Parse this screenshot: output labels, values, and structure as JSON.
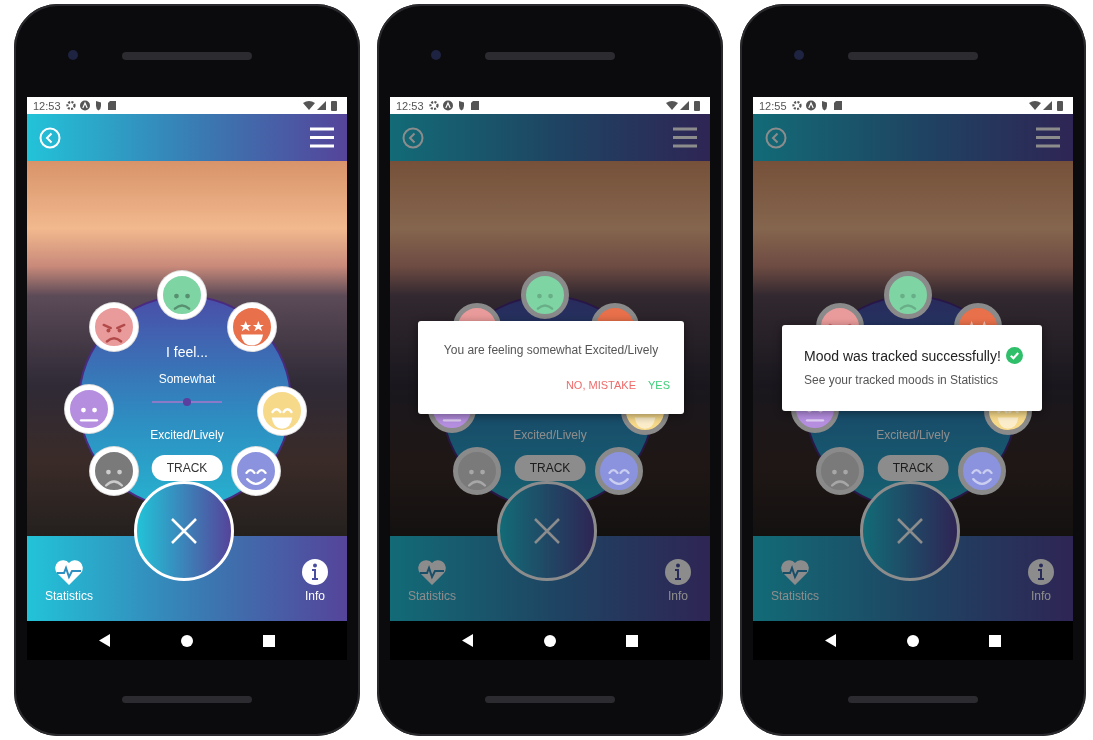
{
  "phones": [
    {
      "status": {
        "time": "12:53"
      },
      "wheel": {
        "faces": [
          {
            "kind": "sad",
            "color": "#7fd4a4"
          },
          {
            "kind": "starstruck",
            "color": "#e8704a"
          },
          {
            "kind": "grinning",
            "color": "#f7d98a"
          },
          {
            "kind": "smiling",
            "color": "#8b93de"
          },
          {
            "kind": "frowning",
            "color": "#7a7a7a"
          },
          {
            "kind": "neutral",
            "color": "#b58ee0"
          },
          {
            "kind": "angry",
            "color": "#e99a9a"
          }
        ],
        "heading": "I feel...",
        "intensity": "Somewhat",
        "slider": {
          "level": 0.5
        },
        "mood": "Excited/Lively",
        "track": "TRACK"
      },
      "nav": [
        {
          "kind": "heart",
          "label": "Statistics"
        },
        {
          "kind": "info",
          "label": "Info"
        }
      ]
    },
    {
      "status": {
        "time": "12:53"
      },
      "wheel": {
        "faces": [
          {
            "kind": "sad",
            "color": "#7fd4a4"
          },
          {
            "kind": "starstruck",
            "color": "#e8704a"
          },
          {
            "kind": "grinning",
            "color": "#f7d98a"
          },
          {
            "kind": "smiling",
            "color": "#8b93de"
          },
          {
            "kind": "frowning",
            "color": "#7a7a7a"
          },
          {
            "kind": "neutral",
            "color": "#b58ee0"
          },
          {
            "kind": "angry",
            "color": "#e99a9a"
          }
        ],
        "mood": "Excited/Lively",
        "track": "TRACK"
      },
      "dialog": {
        "kind": "confirm",
        "message": "You are feeling somewhat Excited/Lively",
        "actions": [
          {
            "label": "NO, MISTAKE",
            "color": "#ef6b6b"
          },
          {
            "label": "YES",
            "color": "#3ecf7a"
          }
        ]
      },
      "nav": [
        {
          "kind": "heart",
          "label": "Statistics"
        },
        {
          "kind": "info",
          "label": "Info"
        }
      ]
    },
    {
      "status": {
        "time": "12:55"
      },
      "wheel": {
        "faces": [
          {
            "kind": "sad",
            "color": "#7fd4a4"
          },
          {
            "kind": "starstruck",
            "color": "#e8704a"
          },
          {
            "kind": "grinning",
            "color": "#f7d98a"
          },
          {
            "kind": "smiling",
            "color": "#8b93de"
          },
          {
            "kind": "frowning",
            "color": "#7a7a7a"
          },
          {
            "kind": "neutral",
            "color": "#b58ee0"
          },
          {
            "kind": "angry",
            "color": "#e99a9a"
          }
        ],
        "mood": "Excited/Lively",
        "track": "TRACK"
      },
      "dialog": {
        "kind": "success",
        "title": "Mood was tracked successfully!",
        "message": "See your tracked moods in Statistics"
      },
      "nav": [
        {
          "kind": "heart",
          "label": "Statistics"
        },
        {
          "kind": "info",
          "label": "Info"
        }
      ]
    }
  ]
}
